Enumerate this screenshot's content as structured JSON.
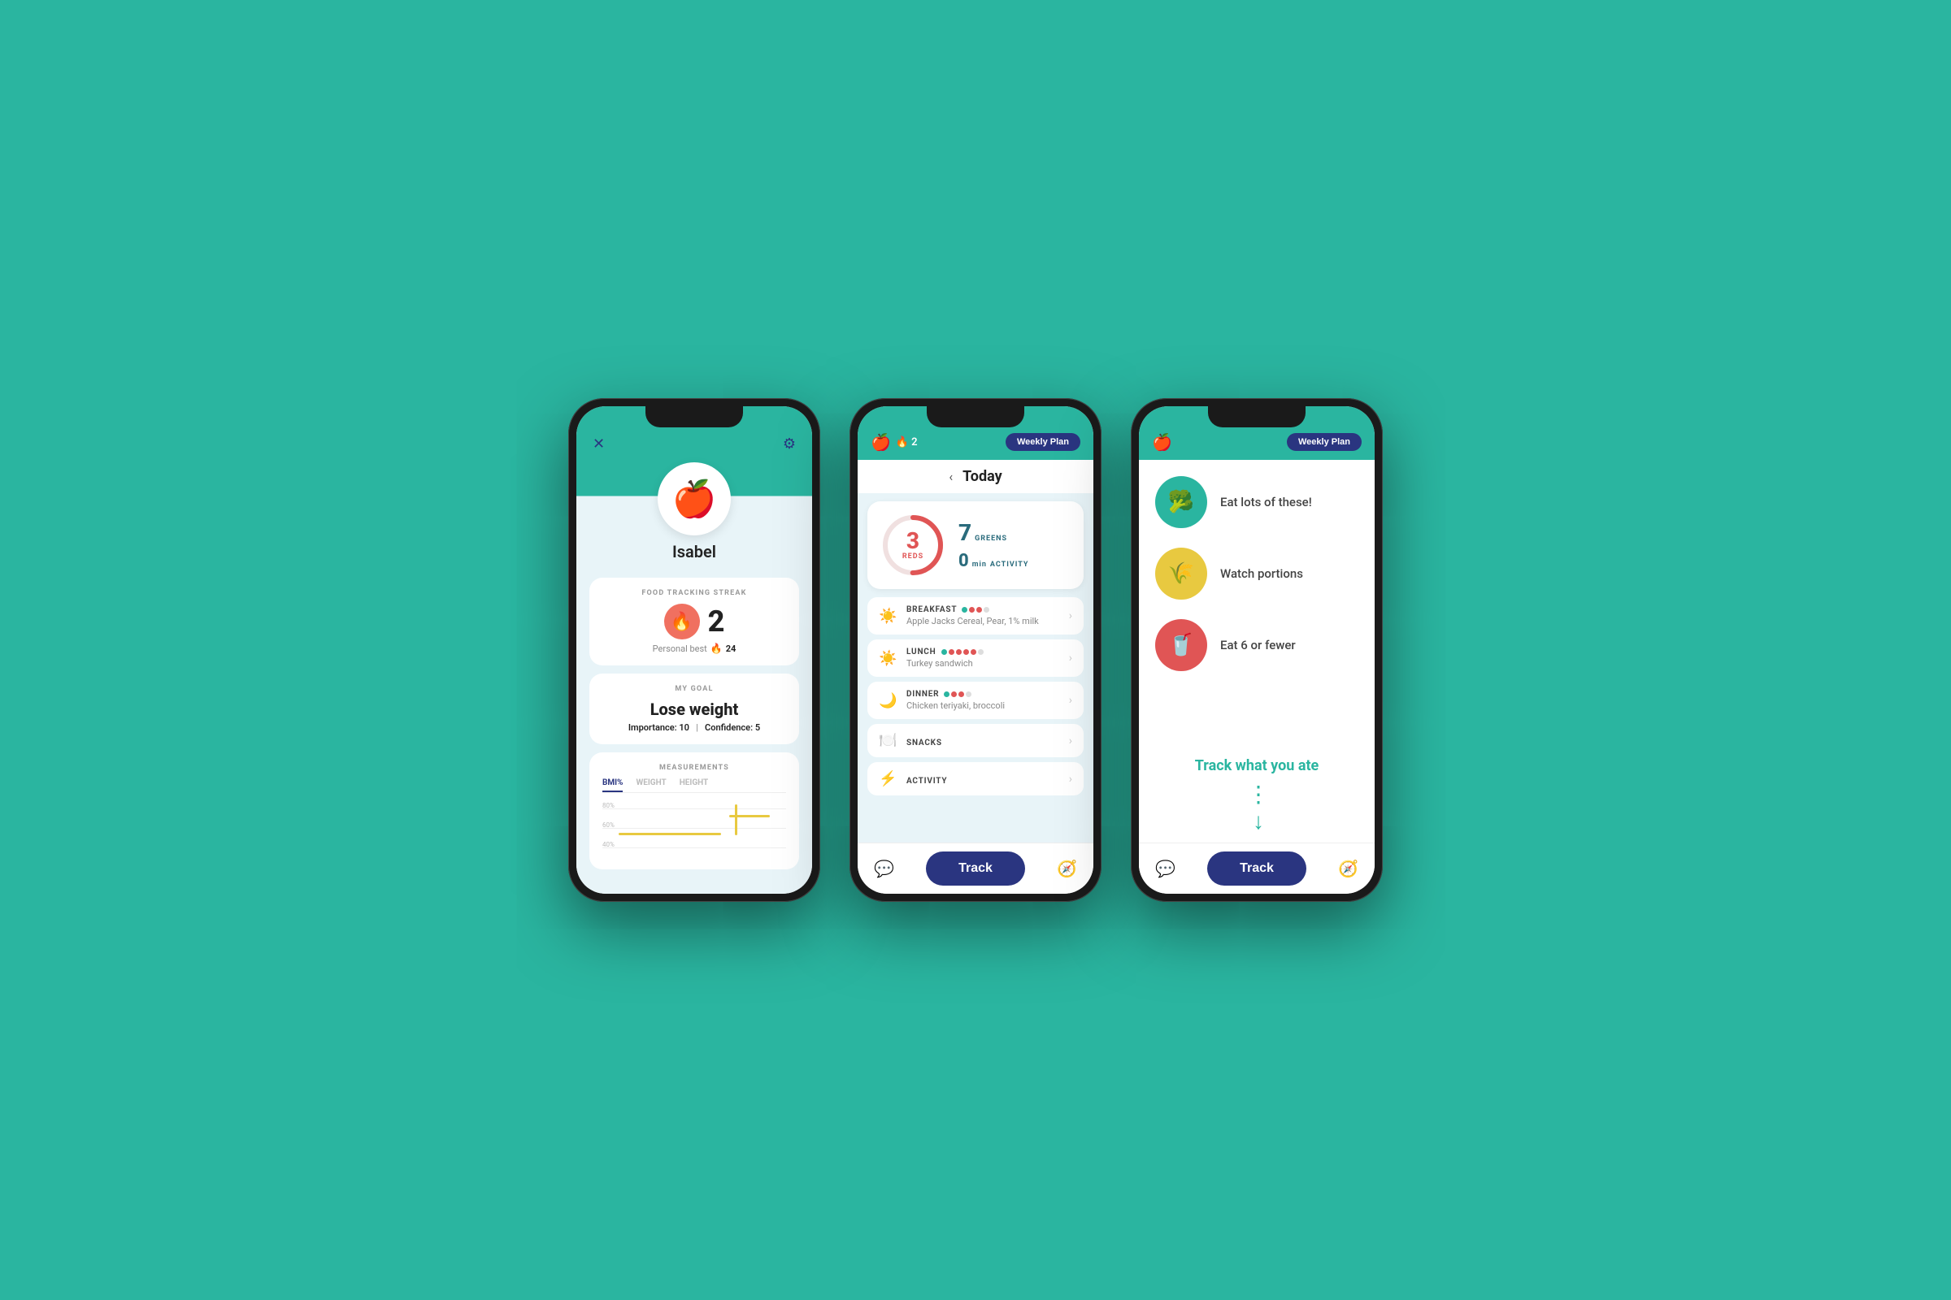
{
  "background_color": "#2ab5a0",
  "phone1": {
    "user": {
      "name": "Isabel",
      "avatar_emoji": "🍎"
    },
    "streak": {
      "label": "FOOD TRACKING STREAK",
      "count": "2",
      "personal_best_label": "Personal best",
      "personal_best_count": "24"
    },
    "goal": {
      "label": "MY GOAL",
      "value": "Lose weight",
      "importance_label": "Importance:",
      "importance_value": "10",
      "confidence_label": "Confidence:",
      "confidence_value": "5"
    },
    "measurements": {
      "label": "MEASUREMENTS",
      "tabs": [
        "BMI%",
        "WEIGHT",
        "HEIGHT"
      ],
      "active_tab": "BMI%",
      "grid_lines": [
        "80%",
        "60%",
        "40%"
      ]
    },
    "header_icons": {
      "close": "✕",
      "settings": "⚙"
    }
  },
  "phone2": {
    "header": {
      "streak_count": "2",
      "weekly_plan_label": "Weekly Plan"
    },
    "today": {
      "nav_label": "Today",
      "reds_count": "3",
      "reds_label": "REDS",
      "greens_count": "7",
      "greens_label": "GREENS",
      "activity_count": "0",
      "activity_unit": "min",
      "activity_label": "ACTIVITY"
    },
    "meals": [
      {
        "name": "BREAKFAST",
        "description": "Apple Jacks Cereal, Pear, 1% milk",
        "icon": "☀",
        "dots": [
          "green",
          "red",
          "red",
          "empty"
        ]
      },
      {
        "name": "LUNCH",
        "description": "Turkey sandwich",
        "icon": "☀",
        "dots": [
          "green",
          "red",
          "red",
          "red",
          "red",
          "empty"
        ]
      },
      {
        "name": "DINNER",
        "description": "Chicken teriyaki, broccoli",
        "icon": "🌙",
        "dots": [
          "green",
          "red",
          "red",
          "empty"
        ]
      },
      {
        "name": "SNACKS",
        "description": "",
        "icon": "🍽",
        "dots": []
      },
      {
        "name": "ACTIVITY",
        "description": "",
        "icon": "⚡",
        "dots": []
      }
    ],
    "footer": {
      "track_label": "Track",
      "chat_icon": "💬",
      "compass_icon": "🧭"
    }
  },
  "phone3": {
    "header": {
      "weekly_plan_label": "Weekly Plan"
    },
    "tips": [
      {
        "color": "green",
        "emoji": "🥦",
        "text": "Eat lots of these!"
      },
      {
        "color": "yellow",
        "emoji": "🌾",
        "text": "Watch portions"
      },
      {
        "color": "red",
        "emoji": "🥤",
        "text": "Eat 6 or fewer"
      }
    ],
    "cta": {
      "text": "Track what you ate",
      "arrow": "⬇"
    },
    "footer": {
      "track_label": "Track"
    }
  }
}
